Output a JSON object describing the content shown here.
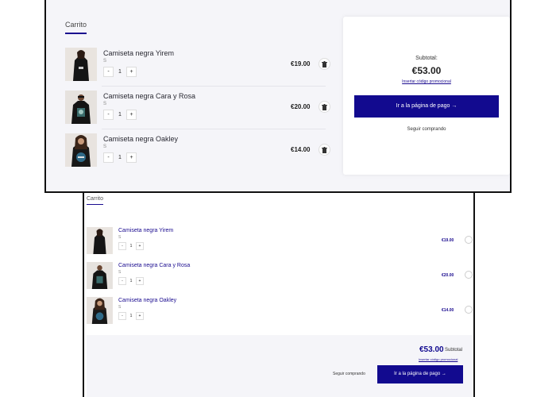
{
  "desktop": {
    "cart_title": "Carrito",
    "items": [
      {
        "name": "Camiseta negra Yirem",
        "size": "S",
        "qty": "1",
        "minus": "-",
        "plus": "+",
        "price": "€19.00"
      },
      {
        "name": "Camiseta negra Cara y Rosa",
        "size": "S",
        "qty": "1",
        "minus": "-",
        "plus": "+",
        "price": "€20.00"
      },
      {
        "name": "Camiseta negra Oakley",
        "size": "S",
        "qty": "1",
        "minus": "-",
        "plus": "+",
        "price": "€14.00"
      }
    ],
    "summary": {
      "subtotal_label": "Subtotal:",
      "subtotal_value": "€53.00",
      "promo_link": "Insertar código promocional",
      "checkout_button": "Ir a la página de pago →",
      "continue_link": "Seguir comprando"
    }
  },
  "mobile": {
    "cart_title": "Carrito",
    "items": [
      {
        "name": "Camiseta negra Yirem",
        "size": "S",
        "qty": "1",
        "minus": "-",
        "plus": "+",
        "price": "€19.00"
      },
      {
        "name": "Camiseta negra Cara y Rosa",
        "size": "S",
        "qty": "1",
        "minus": "-",
        "plus": "+",
        "price": "€20.00"
      },
      {
        "name": "Camiseta negra Oakley",
        "size": "S",
        "qty": "1",
        "minus": "-",
        "plus": "+",
        "price": "€14.00"
      }
    ],
    "summary": {
      "subtotal_value": "€53.00",
      "subtotal_label": "Subtotal",
      "promo_link": "Insertar código promocional",
      "continue_link": "Seguir comprando",
      "checkout_button": "Ir a la página de pago →"
    }
  },
  "colors": {
    "accent": "#120a8f",
    "panel_bg": "#f5f5f9",
    "card_bg": "#ffffff"
  },
  "icons": {
    "trash": "trash-icon",
    "product": "product-thumbnail"
  }
}
